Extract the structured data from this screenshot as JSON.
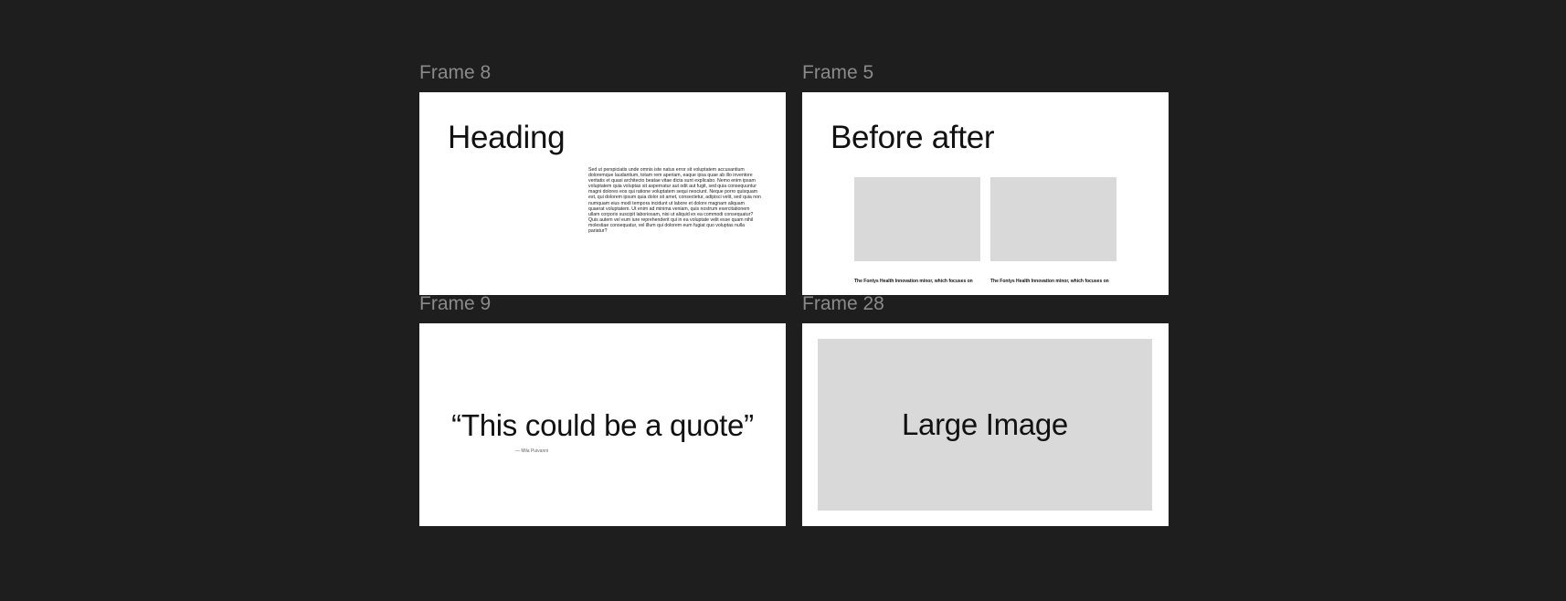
{
  "colors": {
    "canvas_background": "#1e1e1e",
    "frame_label": "#8a8a8a",
    "frame_background": "#ffffff",
    "placeholder_gray": "#d9d9d9",
    "text_dark": "#111111"
  },
  "frames": {
    "frame8": {
      "label": "Frame 8",
      "heading": "Heading",
      "body": "Sed ut perspiciatis unde omnis iste natus error sit voluptatem accusantium doloremque laudantium, totam rem aperiam, eaque ipsa quae ab illo inventore veritatis et quasi architecto beatae vitae dicta sunt explicabo. Nemo enim ipsam voluptatem quia voluptas sit aspernatur aut odit aut fugit, sed quia consequuntur magni dolores eos qui ratione voluptatem sequi nesciunt. Neque porro quisquam est, qui dolorem ipsum quia dolor sit amet, consectetur, adipisci velit, sed quia non numquam eius modi tempora incidunt ut labore et dolore magnam aliquam quaerat voluptatem. Ut enim ad minima veniam, quis nostrum exercitationem ullam corporis suscipit laboriosam, nisi ut aliquid ex ea commodi consequatur? Quis autem vel eum iure reprehenderit qui in ea voluptate velit esse quam nihil molestiae consequatur, vel illum qui dolorem eum fugiat quo voluptas nulla pariatur?"
    },
    "frame5": {
      "label": "Frame 5",
      "heading": "Before after",
      "caption_left": "The Fontys Health Innovation minor, which focuses on",
      "caption_right": "The Fontys Health Innovation minor, which focuses on"
    },
    "frame9": {
      "label": "Frame 9",
      "quote": "“This could be a quote”",
      "author": "— Mila Puivanni"
    },
    "frame28": {
      "label": "Frame 28",
      "image_label": "Large Image"
    }
  }
}
